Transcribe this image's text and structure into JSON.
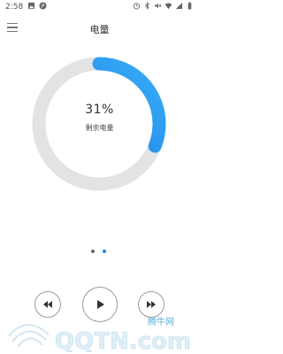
{
  "status_bar": {
    "time": "2:58",
    "left_icons": [
      "image-icon",
      "parking-icon"
    ],
    "right_icons": [
      "alarm-icon",
      "bluetooth-icon",
      "mute-icon",
      "wifi-icon",
      "signal-icon",
      "battery-icon"
    ]
  },
  "app_bar": {
    "title": "电量"
  },
  "battery": {
    "percent_text": "31%",
    "label": "剩余电量",
    "level": 0.31
  },
  "pager": {
    "count": 2,
    "active_index": 1
  },
  "controls": [
    "rewind-icon",
    "play-icon",
    "fast-forward-icon"
  ],
  "watermark": {
    "cn_text": "腾牛网",
    "latin_text": "QQTN.com"
  },
  "colors": {
    "accent_start": "#0d6fe8",
    "accent_end": "#3aaef5",
    "track": "#e3e3e3",
    "active_dot": "#1e88e5",
    "watermark": "#5ab0d8"
  }
}
